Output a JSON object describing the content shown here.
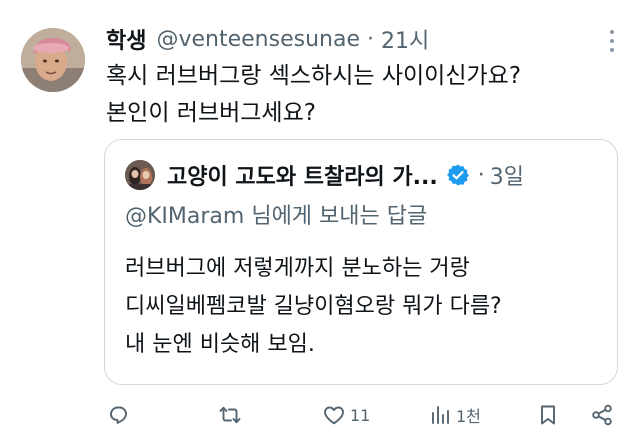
{
  "tweet": {
    "display_name": "학생",
    "handle": "@venteensesunae",
    "separator": "·",
    "time": "21시",
    "text_lines": [
      "혹시 러브버그랑 섹스하시는 사이이신가요?",
      "본인이 러브버그세요?"
    ]
  },
  "quote": {
    "display_name": "고양이 고도와 트찰라의 가...",
    "separator": "·",
    "time": "3일",
    "reply_to": "@KIMaram 님에게 보내는 답글",
    "text_lines": [
      "러브버그에 저렇게까지 분노하는 거랑",
      "디씨일베펨코발 길냥이혐오랑 뭐가 다름?",
      "내 눈엔 비슷해 보임."
    ]
  },
  "actions": {
    "reply_count": "",
    "retweet_count": "",
    "like_count": "11",
    "view_count": "1천"
  },
  "colors": {
    "text": "#0f1419",
    "secondary": "#536471",
    "border": "#cfd9de",
    "verified": "#1d9bf0"
  },
  "icons": [
    "more-icon",
    "verified-badge-icon",
    "reply-icon",
    "retweet-icon",
    "like-icon",
    "views-icon",
    "bookmark-icon",
    "share-icon"
  ]
}
